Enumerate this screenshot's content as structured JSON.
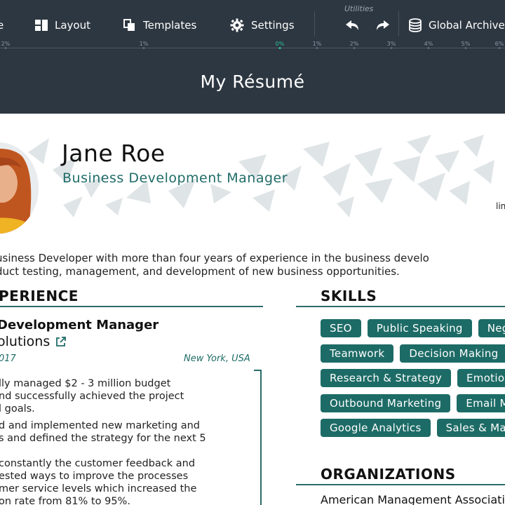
{
  "toolbar": {
    "items": [
      {
        "label": "e",
        "icon": "file-icon"
      },
      {
        "label": "Layout",
        "icon": "layout-icon"
      },
      {
        "label": "Templates",
        "icon": "templates-icon"
      },
      {
        "label": "Settings",
        "icon": "gear-icon"
      },
      {
        "label": "Global Archive",
        "icon": "database-icon"
      }
    ],
    "utilities_label": "Utilities",
    "undo_icon": "undo-icon",
    "redo_icon": "redo-icon"
  },
  "spacing_scale": {
    "ticks": [
      "2%",
      "1%",
      "0%",
      "1%",
      "2%",
      "3%",
      "4%",
      "5%",
      "6%"
    ],
    "active_index": 2
  },
  "title": "My Résumé",
  "resume": {
    "name": "Jane Roe",
    "role": "Business Development Manager",
    "link_fragment": "lin",
    "summary_lines": [
      "usiness Developer with more than four years of experience in the business develo",
      "duct testing, management, and development of new business opportunities."
    ],
    "experience": {
      "heading": "PERIENCE",
      "job_title": "Development Manager",
      "company": "olutions",
      "date": "017",
      "location": "New York, USA",
      "bullets": [
        [
          "lly managed $2 - 3 million budget",
          "nd successfully achieved the project",
          "l goals."
        ],
        [
          "d and implemented new marketing and",
          "s and defined the strategy for the next 5"
        ],
        [
          " constantly the customer feedback and",
          "ested ways to improve the processes",
          "mer service levels which increased the",
          "on rate from 81% to 95%."
        ]
      ]
    },
    "skills": {
      "heading": "SKILLS",
      "rows": [
        [
          "SEO",
          "Public Speaking",
          "Negotiation"
        ],
        [
          "Teamwork",
          "Decision Making"
        ],
        [
          "Research & Strategy",
          "Emotional Intelligence"
        ],
        [
          "Outbound Marketing",
          "Email Marketing"
        ],
        [
          "Google Analytics",
          "Sales & Marketing"
        ]
      ]
    },
    "organizations": {
      "heading": "ORGANIZATIONS",
      "first_item": "American Management Association"
    }
  },
  "colors": {
    "toolbar_bg": "#2d3741",
    "accent": "#1d6b66",
    "active_tick": "#2ec4a0"
  }
}
